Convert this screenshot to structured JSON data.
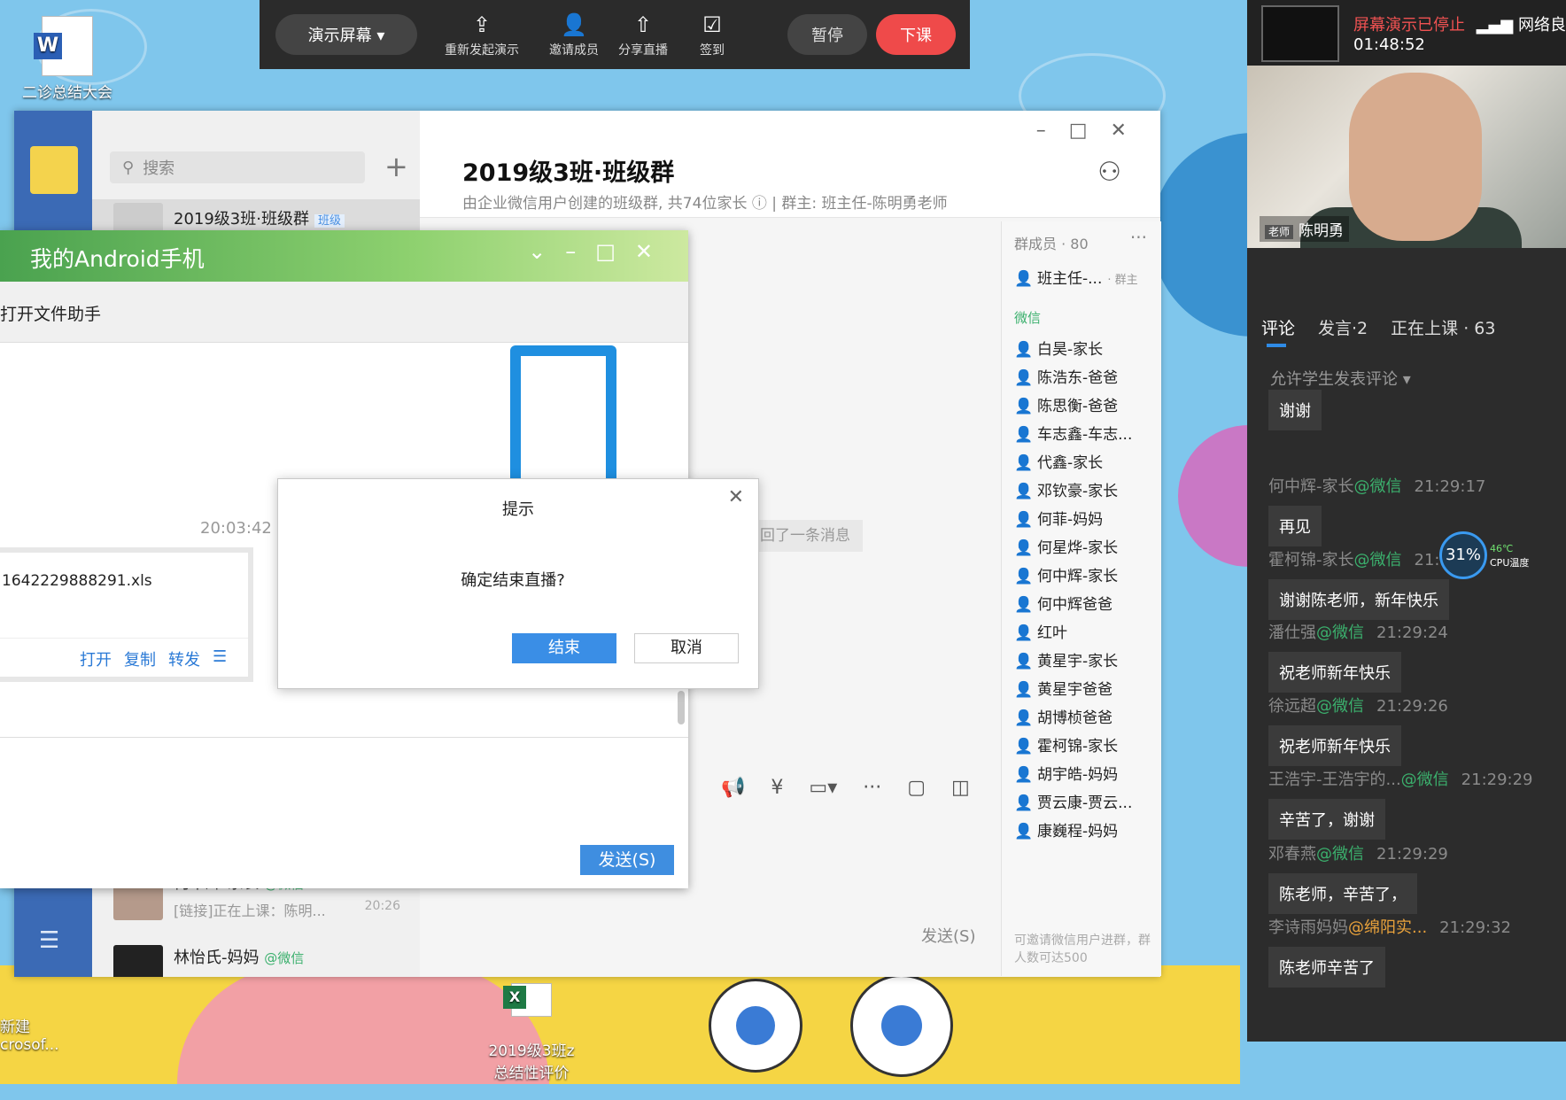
{
  "topbar": {
    "present_label": "演示屏幕 ▾",
    "items": [
      {
        "icon": "upload-screen-icon",
        "label": "重新发起演示"
      },
      {
        "icon": "invite-member-icon",
        "label": "邀请成员"
      },
      {
        "icon": "share-live-icon",
        "label": "分享直播"
      },
      {
        "icon": "checkin-icon",
        "label": "签到"
      }
    ],
    "pause_label": "暂停",
    "end_class_label": "下课"
  },
  "desktop": {
    "icons": [
      {
        "name": "word-doc",
        "label": "二诊总结大会"
      },
      {
        "name": "excel-doc",
        "label": "2019级3班z\n总结性评价"
      },
      {
        "name": "new-doc",
        "label": "新建\ncrosof..."
      }
    ]
  },
  "wecom": {
    "search_placeholder": "搜索",
    "conversations": [
      {
        "name": "2019级3班·班级群",
        "tag": "班级",
        "sub": "",
        "time": ""
      },
      {
        "name": "何中辉-家长",
        "tag_wx": "@微信",
        "sub": "[链接]正在上课：陈明...",
        "time": "20:26"
      },
      {
        "name": "林怡氏-妈妈",
        "tag_wx": "@微信",
        "sub": "",
        "time": ""
      }
    ],
    "chat_title": "2019级3班·班级群",
    "chat_subtitle": "由企业微信用户创建的班级群, 共74位家长 ⓘ  | 群主: 班主任-陈明勇老师",
    "recall_message": "回了一条消息",
    "send_label": "发送(S)",
    "members_header": "群成员 · 80",
    "owner": {
      "name": "班主任-...",
      "badge": "· 群主"
    },
    "wechat_section": "微信",
    "members": [
      {
        "name": "白昊-家长",
        "color": "orange"
      },
      {
        "name": "陈浩东-爸爸",
        "color": "blue"
      },
      {
        "name": "陈思衡-爸爸",
        "color": "blue"
      },
      {
        "name": "车志鑫-车志...",
        "color": "orange"
      },
      {
        "name": "代鑫-家长",
        "color": "orange"
      },
      {
        "name": "邓钦豪-家长",
        "color": "blue"
      },
      {
        "name": "何菲-妈妈",
        "color": "blue"
      },
      {
        "name": "何星烨-家长",
        "color": "orange"
      },
      {
        "name": "何中辉-家长",
        "color": "orange"
      },
      {
        "name": "何中辉爸爸",
        "color": "orange"
      },
      {
        "name": "红叶",
        "color": "blue"
      },
      {
        "name": "黄星宇-家长",
        "color": "orange"
      },
      {
        "name": "黄星宇爸爸",
        "color": "blue"
      },
      {
        "name": "胡博桢爸爸",
        "color": "blue"
      },
      {
        "name": "霍柯锦-家长",
        "color": "orange"
      },
      {
        "name": "胡宇皓-妈妈",
        "color": "orange"
      },
      {
        "name": "贾云康-贾云...",
        "color": "orange"
      },
      {
        "name": "康巍程-妈妈",
        "color": "blue"
      }
    ],
    "members_footer": "可邀请微信用户进群，群人数可达500"
  },
  "android": {
    "title": "我的Android手机",
    "subtitle": "打开文件助手",
    "message_time": "20:03:42",
    "file_name": "1642229888291.xls",
    "file_actions": [
      "打开",
      "复制",
      "转发"
    ],
    "send_label": "发送(S)"
  },
  "dialog": {
    "title": "提示",
    "message": "确定结束直播?",
    "ok_label": "结束",
    "cancel_label": "取消"
  },
  "live": {
    "status": "屏幕演示已停止",
    "timer": "01:48:52",
    "network": "网络良",
    "teacher_role": "老师",
    "teacher_name": "陈明勇",
    "tabs": [
      "评论",
      "发言·2",
      "正在上课 · 63"
    ],
    "allow_comments": "允许学生发表评论 ▾",
    "comments": [
      {
        "user": "",
        "src": "",
        "time": "",
        "text": "谢谢"
      },
      {
        "user": "何中辉-家长",
        "src": "@微信",
        "time": "21:29:17",
        "text": "再见"
      },
      {
        "user": "霍柯锦-家长",
        "src": "@微信",
        "time": "21:",
        "text": "谢谢陈老师，新年快乐"
      },
      {
        "user": "潘仕强",
        "src": "@微信",
        "time": "21:29:24",
        "text": "祝老师新年快乐"
      },
      {
        "user": "徐远超",
        "src": "@微信",
        "time": "21:29:26",
        "text": "祝老师新年快乐"
      },
      {
        "user": "王浩宇-王浩宇的...",
        "src": "@微信",
        "time": "21:29:29",
        "text": "辛苦了，谢谢"
      },
      {
        "user": "邓春燕",
        "src": "@微信",
        "time": "21:29:29",
        "text": "陈老师，辛苦了，"
      },
      {
        "user": "李诗雨妈妈",
        "src": "@绵阳实...",
        "time": "21:29:32",
        "text": "陈老师辛苦了"
      }
    ],
    "cpu_percent": "31%",
    "cpu_temp": "46℃",
    "cpu_label": "CPU温度"
  }
}
